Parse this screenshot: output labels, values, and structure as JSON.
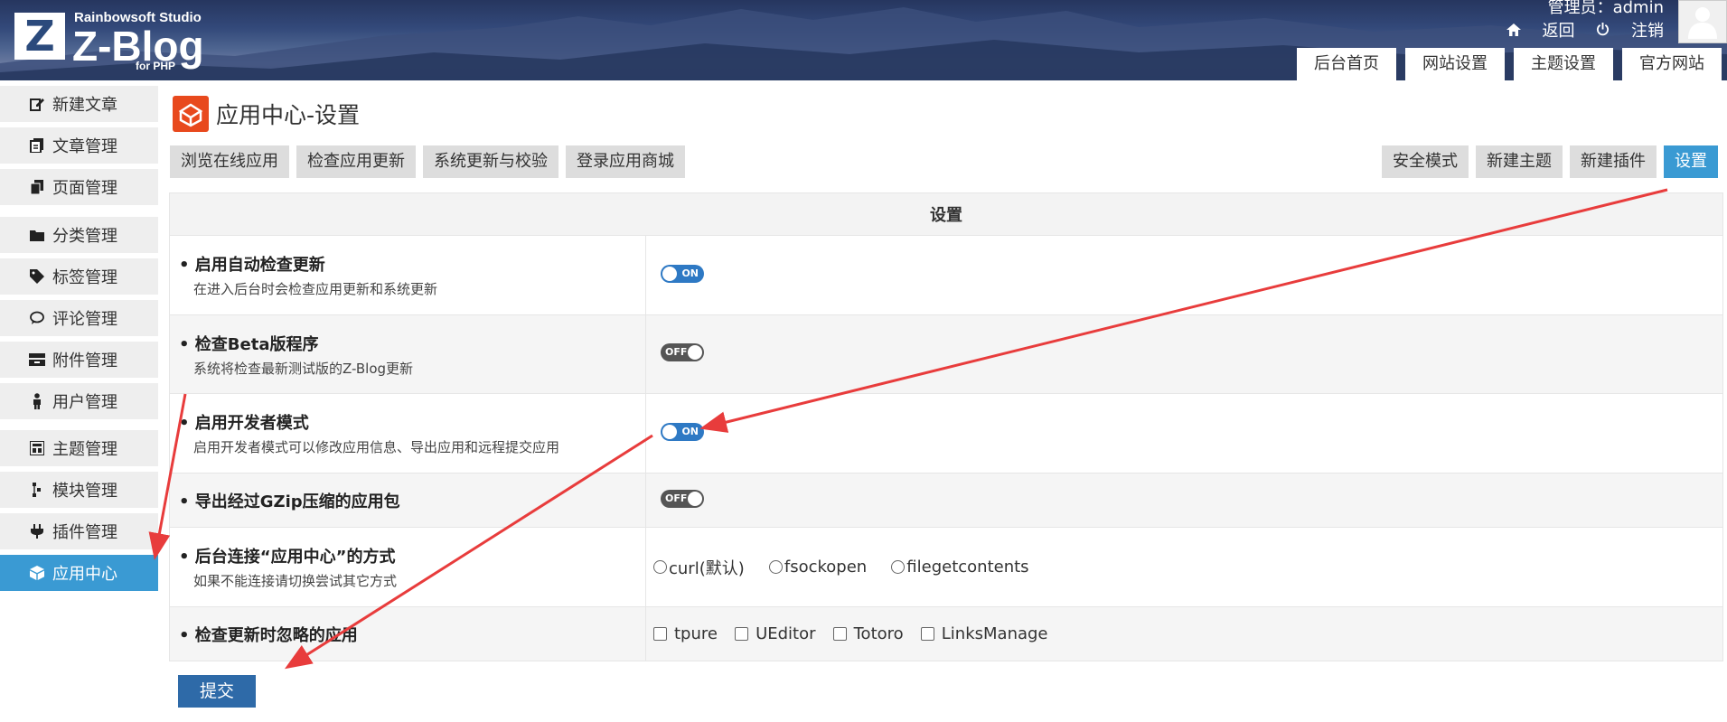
{
  "header": {
    "studio": "Rainbowsoft Studio",
    "brand": "Z-Blog",
    "brand_sub": "for PHP",
    "logo_letter": "Z",
    "admin_line": "管理员：admin",
    "back": "返回",
    "logout": "注销",
    "tabs": [
      "后台首页",
      "网站设置",
      "主题设置",
      "官方网站"
    ]
  },
  "sidebar": {
    "items": [
      {
        "label": "新建文章",
        "icon": "edit-icon"
      },
      {
        "label": "文章管理",
        "icon": "articles-icon"
      },
      {
        "label": "页面管理",
        "icon": "pages-icon"
      },
      {
        "label": "分类管理",
        "icon": "folder-icon"
      },
      {
        "label": "标签管理",
        "icon": "tag-icon"
      },
      {
        "label": "评论管理",
        "icon": "comment-icon"
      },
      {
        "label": "附件管理",
        "icon": "attachment-icon"
      },
      {
        "label": "用户管理",
        "icon": "user-icon"
      },
      {
        "label": "主题管理",
        "icon": "theme-icon"
      },
      {
        "label": "模块管理",
        "icon": "module-icon"
      },
      {
        "label": "插件管理",
        "icon": "plugin-icon"
      },
      {
        "label": "应用中心",
        "icon": "app-center-icon"
      }
    ],
    "active_item": "应用中心"
  },
  "page": {
    "title": "应用中心-设置",
    "left_buttons": [
      "浏览在线应用",
      "检查应用更新",
      "系统更新与校验",
      "登录应用商城"
    ],
    "right_buttons": [
      "安全模式",
      "新建主题",
      "新建插件",
      "设置"
    ],
    "active_button": "设置"
  },
  "settings": {
    "table_header": "设置",
    "rows": {
      "auto_check": {
        "title": "启用自动检查更新",
        "desc": "在进入后台时会检查应用更新和系统更新",
        "state": "ON"
      },
      "beta": {
        "title": "检查Beta版程序",
        "desc": "系统将检查最新测试版的Z-Blog更新",
        "state": "OFF"
      },
      "dev_mode": {
        "title": "启用开发者模式",
        "desc": "启用开发者模式可以修改应用信息、导出应用和远程提交应用",
        "state": "ON"
      },
      "gzip": {
        "title": "导出经过GZip压缩的应用包",
        "state": "OFF"
      },
      "connect": {
        "title": "后台连接“应用中心”的方式",
        "desc": "如果不能连接请切换尝试其它方式",
        "options": [
          "curl(默认)",
          "fsockopen",
          "filegetcontents"
        ]
      },
      "ignore": {
        "title": "检查更新时忽略的应用",
        "options": [
          "tpure",
          "UEditor",
          "Totoro",
          "LinksManage"
        ]
      }
    },
    "submit": "提交"
  },
  "colors": {
    "accent": "#3a9ad3",
    "submit": "#2e6aa8",
    "toggle_on": "#2e79c4",
    "toggle_off": "#555555",
    "title_icon": "#e8491d",
    "annotation_arrow": "#e83c3c"
  }
}
